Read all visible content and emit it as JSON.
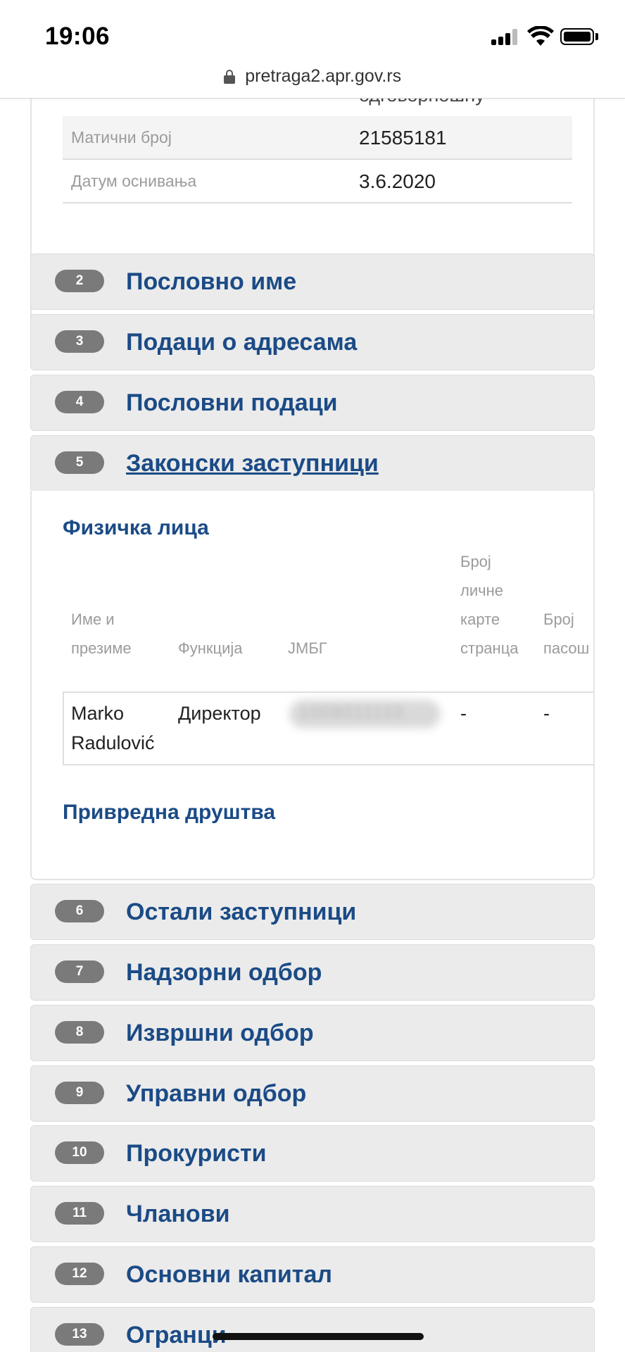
{
  "status_bar": {
    "time": "19:06"
  },
  "browser": {
    "url": "pretraga2.apr.gov.rs"
  },
  "section1": {
    "cut_text": "одговорношћу",
    "rows": [
      {
        "label": "Матични број",
        "value": "21585181"
      },
      {
        "label": "Датум оснивања",
        "value": "3.6.2020"
      }
    ]
  },
  "sections_top": [
    {
      "num": "2",
      "title": "Пословно име"
    },
    {
      "num": "3",
      "title": "Подаци о адресама"
    },
    {
      "num": "4",
      "title": "Пословни подаци"
    }
  ],
  "section5": {
    "num": "5",
    "title": "Законски заступници",
    "natural_persons_title": "Физичка лица",
    "table": {
      "headers": {
        "name_line1": "Име и",
        "name_line2": "презиме",
        "function": "Функција",
        "jmbg": "ЈМБГ",
        "id_line1": "Број",
        "id_line2": "личне",
        "id_line3": "карте",
        "id_line4": "странца",
        "passport_line1": "Број",
        "passport_line2": "пасош"
      },
      "rows": [
        {
          "name_line1": "Marko",
          "name_line2": "Radulović",
          "function": "Директор",
          "jmbg": "1008011110",
          "foreign_id": "-",
          "passport": "-"
        }
      ]
    },
    "companies_title": "Привредна друштва"
  },
  "sections_bottom": [
    {
      "num": "6",
      "title": "Остали заступници"
    },
    {
      "num": "7",
      "title": "Надзорни одбор"
    },
    {
      "num": "8",
      "title": "Извршни одбор"
    },
    {
      "num": "9",
      "title": "Управни одбор"
    },
    {
      "num": "10",
      "title": "Прокуристи"
    },
    {
      "num": "11",
      "title": "Чланови"
    },
    {
      "num": "12",
      "title": "Основни капитал"
    },
    {
      "num": "13",
      "title": "Огранци"
    }
  ],
  "colors": {
    "heading_blue": "#1b4b86",
    "badge_gray": "#7a7a7a",
    "accordion_bg": "#ebebeb"
  }
}
